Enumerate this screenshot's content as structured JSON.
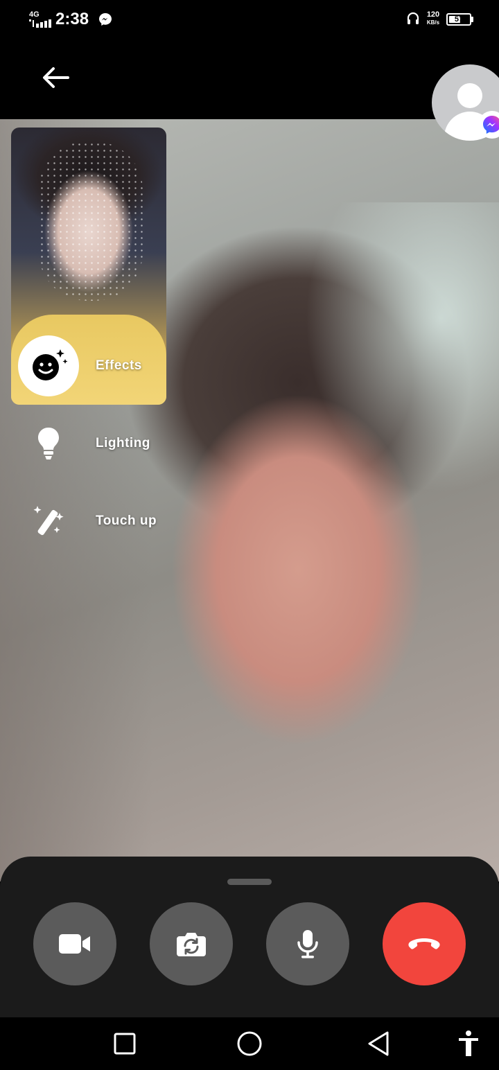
{
  "status_bar": {
    "network_type": "4G",
    "time": "2:38",
    "net_speed_value": "120",
    "net_speed_unit": "KB/s",
    "battery_level": "57",
    "battery_fraction": 0.57
  },
  "call": {
    "remote_avatar_icon": "default-user-avatar",
    "app_badge_icon": "messenger-icon"
  },
  "effects_menu": {
    "items": [
      {
        "label": "Effects",
        "icon": "smiley-sparkle-icon"
      },
      {
        "label": "Lighting",
        "icon": "lightbulb-icon"
      },
      {
        "label": "Touch up",
        "icon": "magic-wand-icon"
      }
    ]
  },
  "controls": {
    "buttons": [
      {
        "icon": "video-camera-icon",
        "action": "toggle-camera"
      },
      {
        "icon": "flip-camera-icon",
        "action": "switch-camera"
      },
      {
        "icon": "microphone-icon",
        "action": "toggle-mic"
      },
      {
        "icon": "end-call-icon",
        "action": "end-call"
      }
    ],
    "end_call_color": "#f2453d"
  },
  "nav_bar": {
    "buttons": [
      "recents-square-icon",
      "home-circle-icon",
      "back-triangle-icon",
      "accessibility-icon"
    ]
  }
}
